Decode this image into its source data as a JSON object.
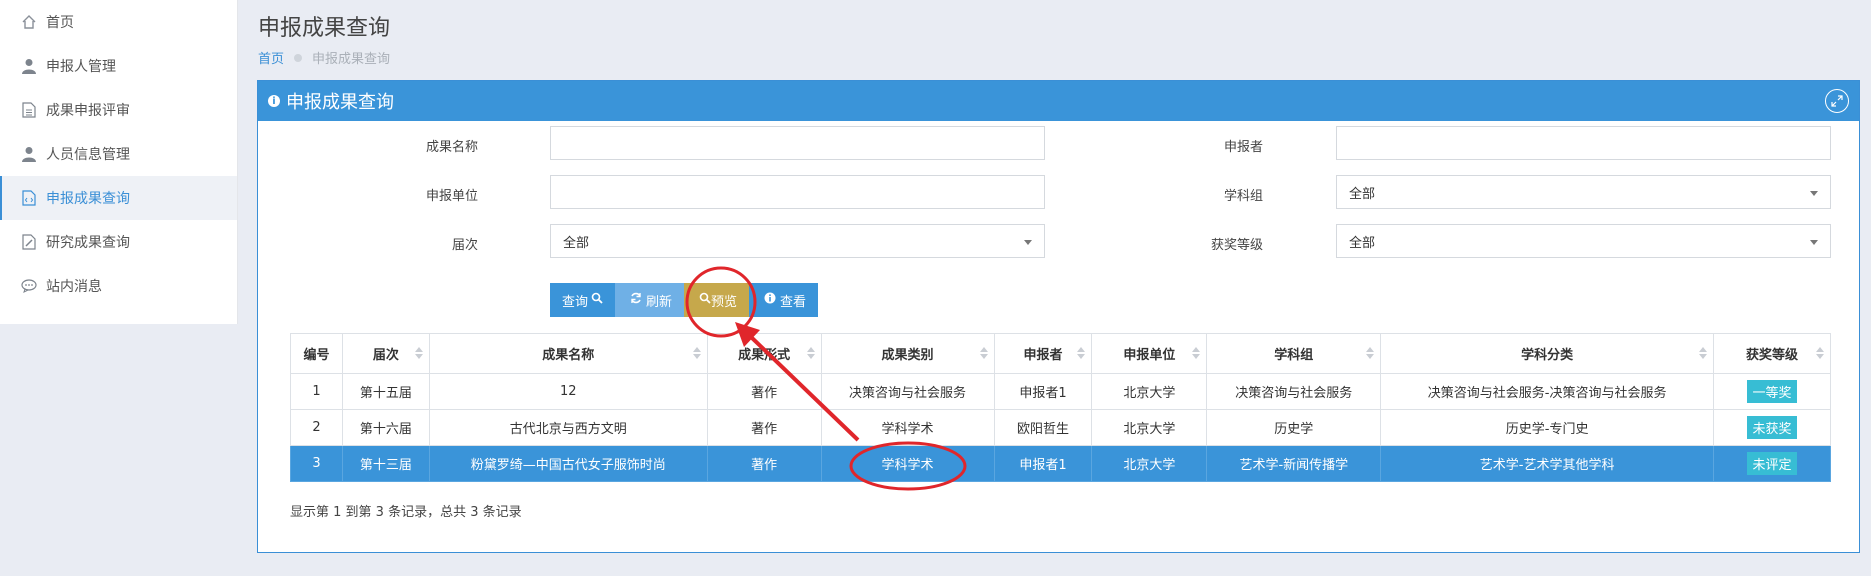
{
  "sidebar": {
    "items": [
      {
        "label": "首页",
        "icon": "home-icon"
      },
      {
        "label": "申报人管理",
        "icon": "user-icon"
      },
      {
        "label": "成果申报评审",
        "icon": "document-icon"
      },
      {
        "label": "人员信息管理",
        "icon": "user-icon"
      },
      {
        "label": "申报成果查询",
        "icon": "code-file-icon",
        "active": true
      },
      {
        "label": "研究成果查询",
        "icon": "edit-file-icon"
      },
      {
        "label": "站内消息",
        "icon": "chat-icon"
      }
    ]
  },
  "header": {
    "title": "申报成果查询",
    "breadcrumb_home": "首页",
    "breadcrumb_current": "申报成果查询"
  },
  "panel": {
    "title": "申报成果查询",
    "form": {
      "result_name_label": "成果名称",
      "result_name_value": "",
      "applicant_label": "申报者",
      "applicant_value": "",
      "unit_label": "申报单位",
      "unit_value": "",
      "subject_group_label": "学科组",
      "subject_group_value": "全部",
      "session_label": "届次",
      "session_value": "全部",
      "award_label": "获奖等级",
      "award_value": "全部"
    },
    "buttons": {
      "query": "查询",
      "refresh": "刷新",
      "preview": "预览",
      "view": "查看"
    },
    "table": {
      "headers": [
        "编号",
        "届次",
        "成果名称",
        "成果形式",
        "成果类别",
        "申报者",
        "申报单位",
        "学科组",
        "学科分类",
        "获奖等级"
      ],
      "rows": [
        [
          "1",
          "第十五届",
          "12",
          "著作",
          "决策咨询与社会服务",
          "申报者1",
          "北京大学",
          "决策咨询与社会服务",
          "决策咨询与社会服务-决策咨询与社会服务",
          "一等奖"
        ],
        [
          "2",
          "第十六届",
          "古代北京与西方文明",
          "著作",
          "学科学术",
          "欧阳哲生",
          "北京大学",
          "历史学",
          "历史学-专门史",
          "未获奖"
        ],
        [
          "3",
          "第十三届",
          "粉黛罗绮—中国古代女子服饰时尚",
          "著作",
          "学科学术",
          "申报者1",
          "北京大学",
          "艺术学-新闻传播学",
          "艺术学-艺术学其他学科",
          "未评定"
        ]
      ]
    },
    "footer": "显示第 1 到第 3 条记录，总共 3 条记录"
  },
  "colors": {
    "primary": "#3a94d9",
    "preview_button": "#c6a84b",
    "badge": "#37bdd4",
    "annotation": "#e0262b"
  }
}
